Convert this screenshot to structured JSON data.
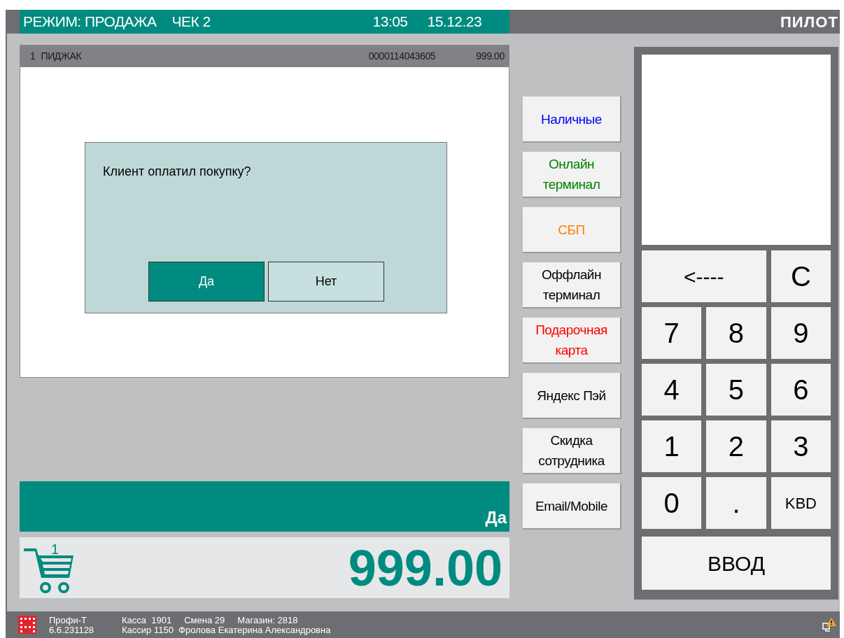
{
  "header": {
    "mode": "РЕЖИМ: ПРОДАЖА",
    "receipt": "ЧЕК 2",
    "time": "13:05",
    "date": "15.12.23",
    "brand": "ПИЛОТ"
  },
  "receipt_lines": [
    {
      "number": "1",
      "name": "ПИДЖАК",
      "barcode": "0000114043605",
      "price": "999.00"
    }
  ],
  "dialog": {
    "question": "Клиент оплатил покупку?",
    "buttons": [
      {
        "label": "Да",
        "selected": true
      },
      {
        "label": "Нет",
        "selected": false
      }
    ]
  },
  "message": "Да",
  "total": {
    "cart_count": "1",
    "amount": "999.00"
  },
  "payment_buttons": [
    {
      "label": "Наличные",
      "color": "#0000ff"
    },
    {
      "label": "Онлайн терминал",
      "color": "#008000"
    },
    {
      "label": "СБП",
      "color": "#ff8000"
    },
    {
      "label": "Оффлайн терминал",
      "color": "#000000"
    },
    {
      "label": "Подарочная карта",
      "color": "#ff0000"
    },
    {
      "label": "Яндекс Пэй",
      "color": "#000000"
    },
    {
      "label": "Скидка сотрудника",
      "color": "#000000"
    },
    {
      "label": "Email/Mobile",
      "color": "#000000"
    }
  ],
  "keypad": [
    {
      "label": "<----",
      "kind": "wide"
    },
    {
      "label": "C",
      "kind": "key"
    },
    {
      "label": "7",
      "kind": "key"
    },
    {
      "label": "8",
      "kind": "key"
    },
    {
      "label": "9",
      "kind": "key"
    },
    {
      "label": "4",
      "kind": "key"
    },
    {
      "label": "5",
      "kind": "key"
    },
    {
      "label": "6",
      "kind": "key"
    },
    {
      "label": "1",
      "kind": "key"
    },
    {
      "label": "2",
      "kind": "key"
    },
    {
      "label": "3",
      "kind": "key"
    },
    {
      "label": "0",
      "kind": "key"
    },
    {
      "label": ".",
      "kind": "key"
    },
    {
      "label": "KBD",
      "kind": "small"
    },
    {
      "label": "ВВОД",
      "kind": "full"
    }
  ],
  "status_bar": {
    "product": "Профи-Т",
    "version": "6.6.231128",
    "register": "Касса  1901",
    "shift": "Смена 29",
    "store": "Магазин: 2818",
    "cashier": "Кассир 1150  Фролова Екатерина Александровна"
  }
}
